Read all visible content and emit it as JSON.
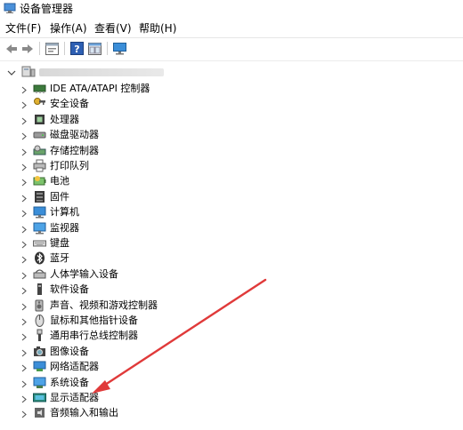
{
  "window": {
    "title": "设备管理器"
  },
  "menu": [
    "文件(F)",
    "操作(A)",
    "查看(V)",
    "帮助(H)"
  ],
  "toolbar": {
    "buttons": [
      "back-icon",
      "forward-icon",
      "properties-icon",
      "help-icon",
      "view-icon",
      "monitor-icon"
    ]
  },
  "tree": {
    "root_name": "",
    "categories": [
      {
        "label": "IDE ATA/ATAPI 控制器",
        "icon": "ide-controller-icon"
      },
      {
        "label": "安全设备",
        "icon": "security-key-icon"
      },
      {
        "label": "处理器",
        "icon": "processor-icon"
      },
      {
        "label": "磁盘驱动器",
        "icon": "disk-drive-icon"
      },
      {
        "label": "存储控制器",
        "icon": "storage-controller-icon"
      },
      {
        "label": "打印队列",
        "icon": "printer-icon"
      },
      {
        "label": "电池",
        "icon": "battery-icon"
      },
      {
        "label": "固件",
        "icon": "firmware-icon"
      },
      {
        "label": "计算机",
        "icon": "computer-icon"
      },
      {
        "label": "监视器",
        "icon": "monitor-icon"
      },
      {
        "label": "键盘",
        "icon": "keyboard-icon"
      },
      {
        "label": "蓝牙",
        "icon": "bluetooth-icon"
      },
      {
        "label": "人体学输入设备",
        "icon": "hid-icon"
      },
      {
        "label": "软件设备",
        "icon": "software-device-icon"
      },
      {
        "label": "声音、视频和游戏控制器",
        "icon": "speaker-icon"
      },
      {
        "label": "鼠标和其他指针设备",
        "icon": "mouse-icon"
      },
      {
        "label": "通用串行总线控制器",
        "icon": "usb-icon"
      },
      {
        "label": "图像设备",
        "icon": "camera-icon"
      },
      {
        "label": "网络适配器",
        "icon": "network-adapter-icon"
      },
      {
        "label": "系统设备",
        "icon": "system-device-icon"
      },
      {
        "label": "显示适配器",
        "icon": "display-adapter-icon"
      },
      {
        "label": "音频输入和输出",
        "icon": "audio-io-icon"
      }
    ]
  },
  "annotation": {
    "color": "#e03a3a",
    "target": "显示适配器"
  }
}
